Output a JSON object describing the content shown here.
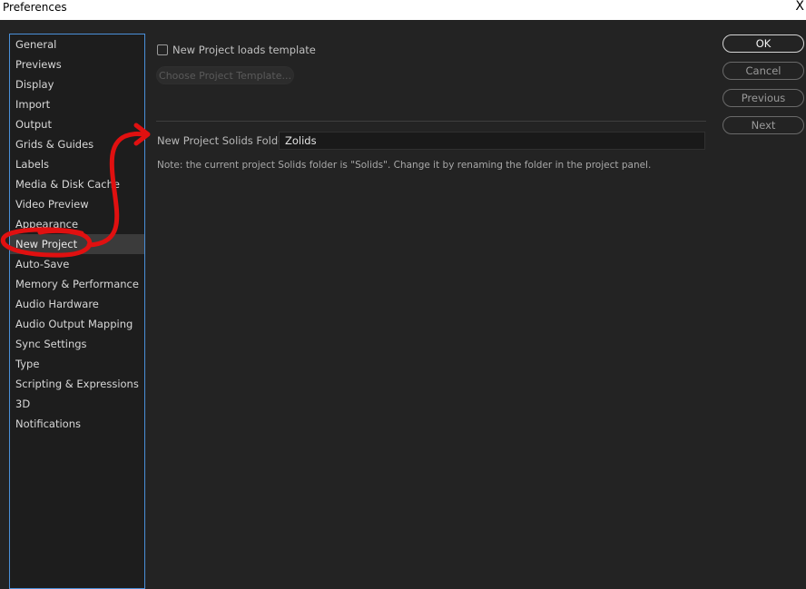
{
  "window": {
    "title": "Preferences",
    "close_glyph": "X"
  },
  "sidebar": {
    "items": [
      {
        "label": "General"
      },
      {
        "label": "Previews"
      },
      {
        "label": "Display"
      },
      {
        "label": "Import"
      },
      {
        "label": "Output"
      },
      {
        "label": "Grids & Guides"
      },
      {
        "label": "Labels"
      },
      {
        "label": "Media & Disk Cache"
      },
      {
        "label": "Video Preview"
      },
      {
        "label": "Appearance"
      },
      {
        "label": "New Project"
      },
      {
        "label": "Auto-Save"
      },
      {
        "label": "Memory & Performance"
      },
      {
        "label": "Audio Hardware"
      },
      {
        "label": "Audio Output Mapping"
      },
      {
        "label": "Sync Settings"
      },
      {
        "label": "Type"
      },
      {
        "label": "Scripting & Expressions"
      },
      {
        "label": "3D"
      },
      {
        "label": "Notifications"
      }
    ],
    "selected": "New Project"
  },
  "panel": {
    "loads_template_label": "New Project loads template",
    "loads_template_checked": false,
    "choose_template_label": "Choose Project Template...",
    "solids_folder_label": "New Project Solids Folder",
    "solids_folder_value": "Zolids",
    "note": "Note: the current project Solids folder is \"Solids\". Change it by renaming the folder in the project panel."
  },
  "buttons": {
    "ok": "OK",
    "cancel": "Cancel",
    "previous": "Previous",
    "next": "Next"
  },
  "colors": {
    "accent_border": "#4a90d9",
    "annotation": "#e01010"
  }
}
